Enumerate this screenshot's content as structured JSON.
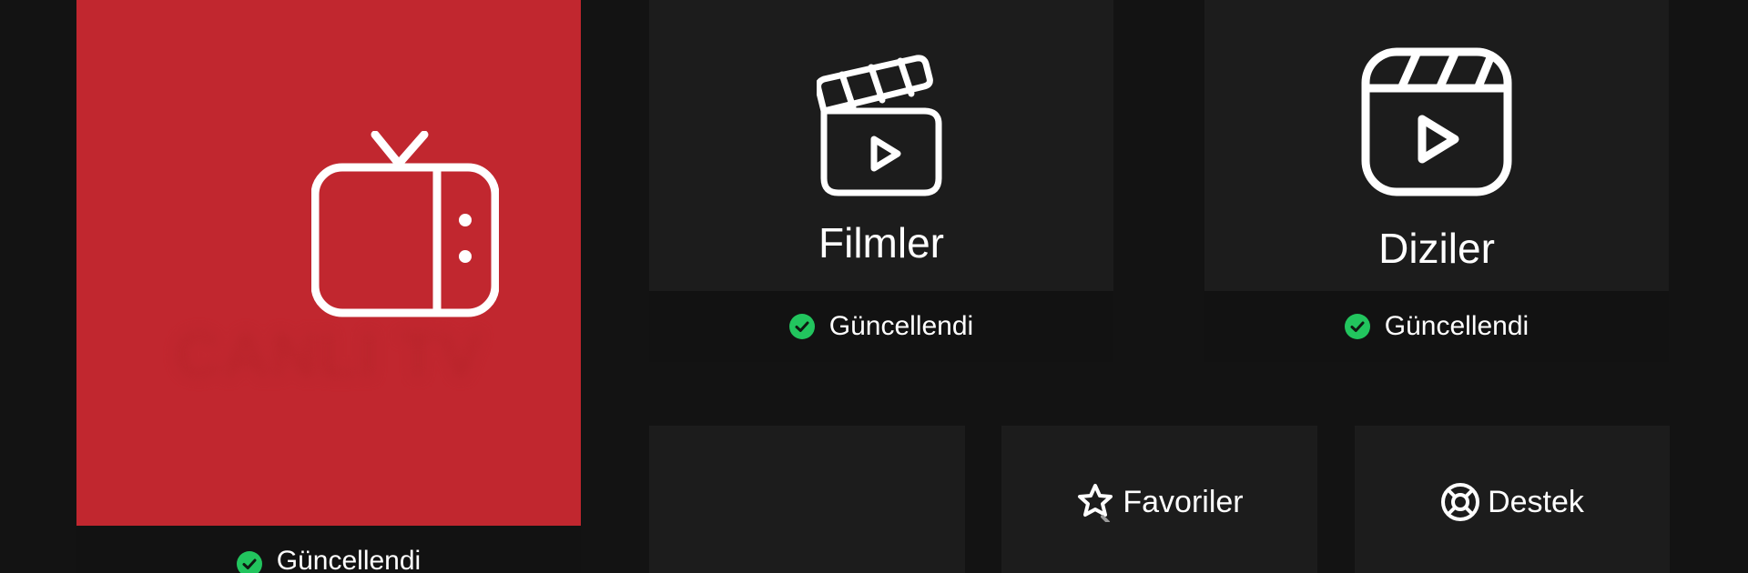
{
  "tiles": {
    "live": {
      "ghost_label": "CANLI TV",
      "status": "Güncellendi",
      "icon": "tv-icon",
      "color": "#c1272f"
    },
    "movies": {
      "title": "Filmler",
      "status": "Güncellendi",
      "icon": "clapperboard-icon"
    },
    "series": {
      "title": "Diziler",
      "status": "Güncellendi",
      "icon": "reels-icon"
    },
    "favorites": {
      "label": "Favoriler",
      "icon": "star-icon"
    },
    "support": {
      "label": "Destek",
      "icon": "lifebuoy-icon"
    }
  },
  "colors": {
    "background": "#131313",
    "tile": "#1c1c1c",
    "status_bar": "#121212",
    "success": "#22c55e",
    "accent": "#c1272f"
  }
}
